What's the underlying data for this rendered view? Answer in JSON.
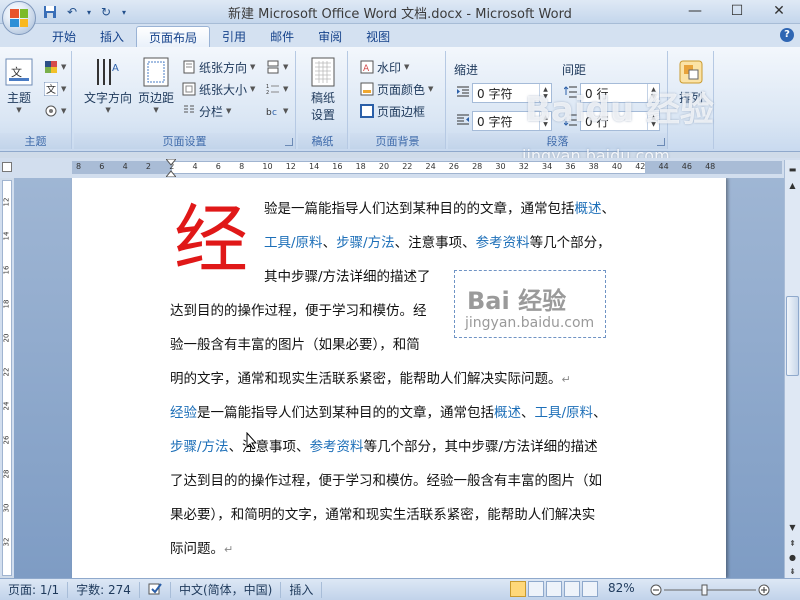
{
  "window": {
    "title": "新建 Microsoft Office Word 文档.docx - Microsoft Word",
    "minimize": "—",
    "maximize": "☐",
    "close": "✕"
  },
  "qat": {
    "save": "💾",
    "undo": "↶",
    "redo": "↻",
    "more": "▾"
  },
  "tabs": [
    "开始",
    "插入",
    "页面布局",
    "引用",
    "邮件",
    "审阅",
    "视图"
  ],
  "active_tab": "页面布局",
  "help": "?",
  "ribbon": {
    "theme": {
      "label": "主题",
      "group": "主题"
    },
    "page_setup": {
      "group": "页面设置",
      "text_direction": "文字方向",
      "margins": "页边距",
      "orientation": "纸张方向",
      "size": "纸张大小",
      "columns": "分栏"
    },
    "manuscript": {
      "label1": "稿纸",
      "label2": "设置",
      "group": "稿纸"
    },
    "page_background": {
      "group": "页面背景",
      "watermark": "水印",
      "page_color": "页面颜色",
      "page_border": "页面边框"
    },
    "paragraph": {
      "group": "段落",
      "indent": "缩进",
      "spacing": "间距",
      "indent_left": "0 字符",
      "indent_right": "0 字符",
      "space_before": "0 行",
      "space_after": "0 行"
    },
    "arrange": {
      "label": "排列"
    }
  },
  "ruler": {
    "h_ticks": [
      "8",
      "6",
      "4",
      "2",
      "2",
      "4",
      "6",
      "8",
      "10",
      "12",
      "14",
      "16",
      "18",
      "20",
      "22",
      "24",
      "26",
      "28",
      "30",
      "32",
      "34",
      "36",
      "38",
      "40",
      "42",
      "44",
      "46",
      "48"
    ],
    "v_ticks": [
      "12",
      "14",
      "16",
      "18",
      "20",
      "22",
      "24",
      "26",
      "28",
      "30",
      "32"
    ]
  },
  "document": {
    "dropcap": "经",
    "p1_line1": [
      {
        "t": "验是一篇能指导人们达到某种目的的文章，通常包括",
        "link": false
      },
      {
        "t": "概述",
        "link": true
      },
      {
        "t": "、",
        "link": false
      }
    ],
    "p1_line2": [
      {
        "t": "工具/原料",
        "link": true
      },
      {
        "t": "、",
        "link": false
      },
      {
        "t": "步骤/方法",
        "link": true
      },
      {
        "t": "、注意事项、",
        "link": false
      },
      {
        "t": "参考资料",
        "link": true
      },
      {
        "t": "等几个部分，",
        "link": false
      }
    ],
    "p1_line3": "其中步骤/方法详细的描述了",
    "p1_line4": "达到目的的操作过程，便于学习和模仿。经",
    "p1_line5": "验一般含有丰富的图片（如果必要），和简",
    "p1_line6": "明的文字，通常和现实生活联系紧密，能帮助人们解决实际问题。",
    "p2_line1": [
      {
        "t": "经验",
        "link": true
      },
      {
        "t": "是一篇能指导人们达到某种目的的文章，通常包括",
        "link": false
      },
      {
        "t": "概述",
        "link": true
      },
      {
        "t": "、",
        "link": false
      },
      {
        "t": "工具/原料",
        "link": true
      },
      {
        "t": "、",
        "link": false
      }
    ],
    "p2_line2": [
      {
        "t": "步骤/方法",
        "link": true
      },
      {
        "t": "、注意事项、",
        "link": false
      },
      {
        "t": "参考资料",
        "link": true
      },
      {
        "t": "等几个部分，其中步骤/方法详细的描述",
        "link": false
      }
    ],
    "p2_line3": "了达到目的的操作过程，便于学习和模仿。经验一般含有丰富的图片（如",
    "p2_line4": "果必要），和简明的文字，通常和现实生活联系紧密，能帮助人们解决实",
    "p2_line5": "际问题。",
    "para_mark": "↵",
    "image_baidu": "Bai 经验",
    "image_site": "jingyan.baidu.com"
  },
  "overlay_watermark": {
    "brand": "Baidu 经验",
    "site": "jingyan.baidu.com"
  },
  "status": {
    "page": "页面: 1/1",
    "words": "字数: 274",
    "lang": "中文(简体，中国)",
    "mode": "插入",
    "zoom": "82%"
  },
  "colors": {
    "accent": "#1d6fb8",
    "dropcap": "#e01818",
    "ribbon_text": "#1e395b"
  }
}
